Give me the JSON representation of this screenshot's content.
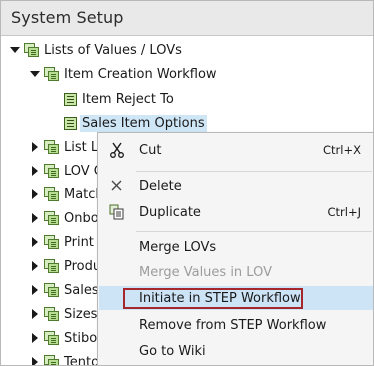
{
  "header": {
    "title": "System Setup"
  },
  "tree": {
    "root": {
      "label": "Lists of Values / LOVs"
    },
    "folder": {
      "label": "Item Creation Workflow"
    },
    "children": [
      {
        "label": "Item Reject To"
      },
      {
        "label": "Sales Item Options"
      }
    ],
    "siblings": [
      {
        "label": "List L"
      },
      {
        "label": "LOV C"
      },
      {
        "label": "Match"
      },
      {
        "label": "Onbo"
      },
      {
        "label": "Print"
      },
      {
        "label": "Produ"
      },
      {
        "label": "Sales"
      },
      {
        "label": "Sizes"
      },
      {
        "label": "Stibo"
      },
      {
        "label": "Tento"
      }
    ]
  },
  "context_menu": {
    "items": [
      {
        "label": "Cut",
        "shortcut": "Ctrl+X",
        "icon": "scissors-icon",
        "disabled": false
      },
      {
        "label": "Delete",
        "shortcut": "",
        "icon": "x-icon",
        "disabled": false
      },
      {
        "label": "Duplicate",
        "shortcut": "Ctrl+J",
        "icon": "duplicate-icon",
        "disabled": false
      },
      {
        "label": "Merge LOVs",
        "shortcut": "",
        "icon": "",
        "disabled": false
      },
      {
        "label": "Merge Values in LOV",
        "shortcut": "",
        "icon": "",
        "disabled": true
      },
      {
        "label": "Initiate in STEP Workflow",
        "shortcut": "",
        "icon": "",
        "disabled": false,
        "highlighted": true
      },
      {
        "label": "Remove from STEP Workflow",
        "shortcut": "",
        "icon": "",
        "disabled": false
      },
      {
        "label": "Go to Wiki",
        "shortcut": "",
        "icon": "",
        "disabled": false
      }
    ]
  },
  "colors": {
    "selection_bg": "#cfe6f7",
    "hover_bg": "#cde4f7",
    "highlight_border": "#a5272b",
    "header_bg": "#e9e9e9"
  }
}
